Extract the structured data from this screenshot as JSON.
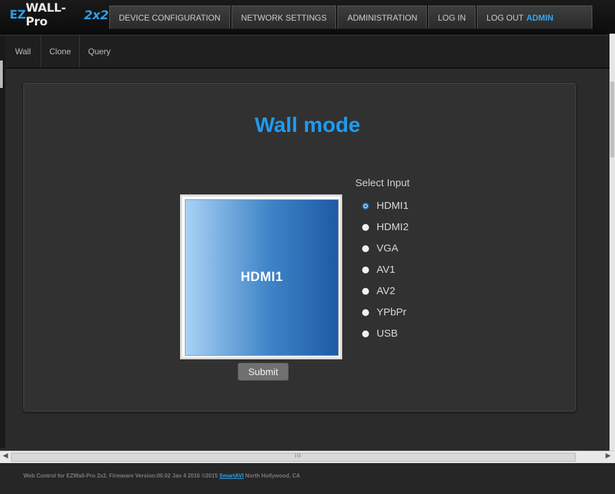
{
  "app": {
    "logo_ez": "EZ",
    "logo_wall": "WALL-Pro",
    "logo_size": "2x2"
  },
  "nav": {
    "tabs": [
      {
        "label": "DEVICE CONFIGURATION"
      },
      {
        "label": "NETWORK SETTINGS"
      },
      {
        "label": "ADMINISTRATION"
      },
      {
        "label": "LOG IN"
      },
      {
        "label": "LOG OUT"
      }
    ],
    "user": "admin"
  },
  "subnav": {
    "tabs": [
      {
        "label": "Wall"
      },
      {
        "label": "Clone"
      },
      {
        "label": "Query"
      }
    ]
  },
  "main": {
    "title": "Wall mode",
    "preview_label": "HDMI1",
    "submit_label": "Submit",
    "select_label": "Select Input",
    "inputs": [
      {
        "label": "HDMI1",
        "checked": true
      },
      {
        "label": "HDMI2",
        "checked": false
      },
      {
        "label": "VGA",
        "checked": false
      },
      {
        "label": "AV1",
        "checked": false
      },
      {
        "label": "AV2",
        "checked": false
      },
      {
        "label": "YPbPr",
        "checked": false
      },
      {
        "label": "USB",
        "checked": false
      }
    ]
  },
  "footer": {
    "text_before": "Web Control for EZWall-Pro 2x2.   Firmware Version:00.02 Jan 4 2016   ©2015 ",
    "brand": "SmartAVI",
    "text_after": " North Hollywood, CA"
  },
  "colors": {
    "accent": "#1e9bf2",
    "background": "#2b2b2b",
    "panel": "#313131"
  },
  "icons": {
    "scroll_left": "◀",
    "scroll_right": "▶",
    "scroll_grip": "III"
  }
}
